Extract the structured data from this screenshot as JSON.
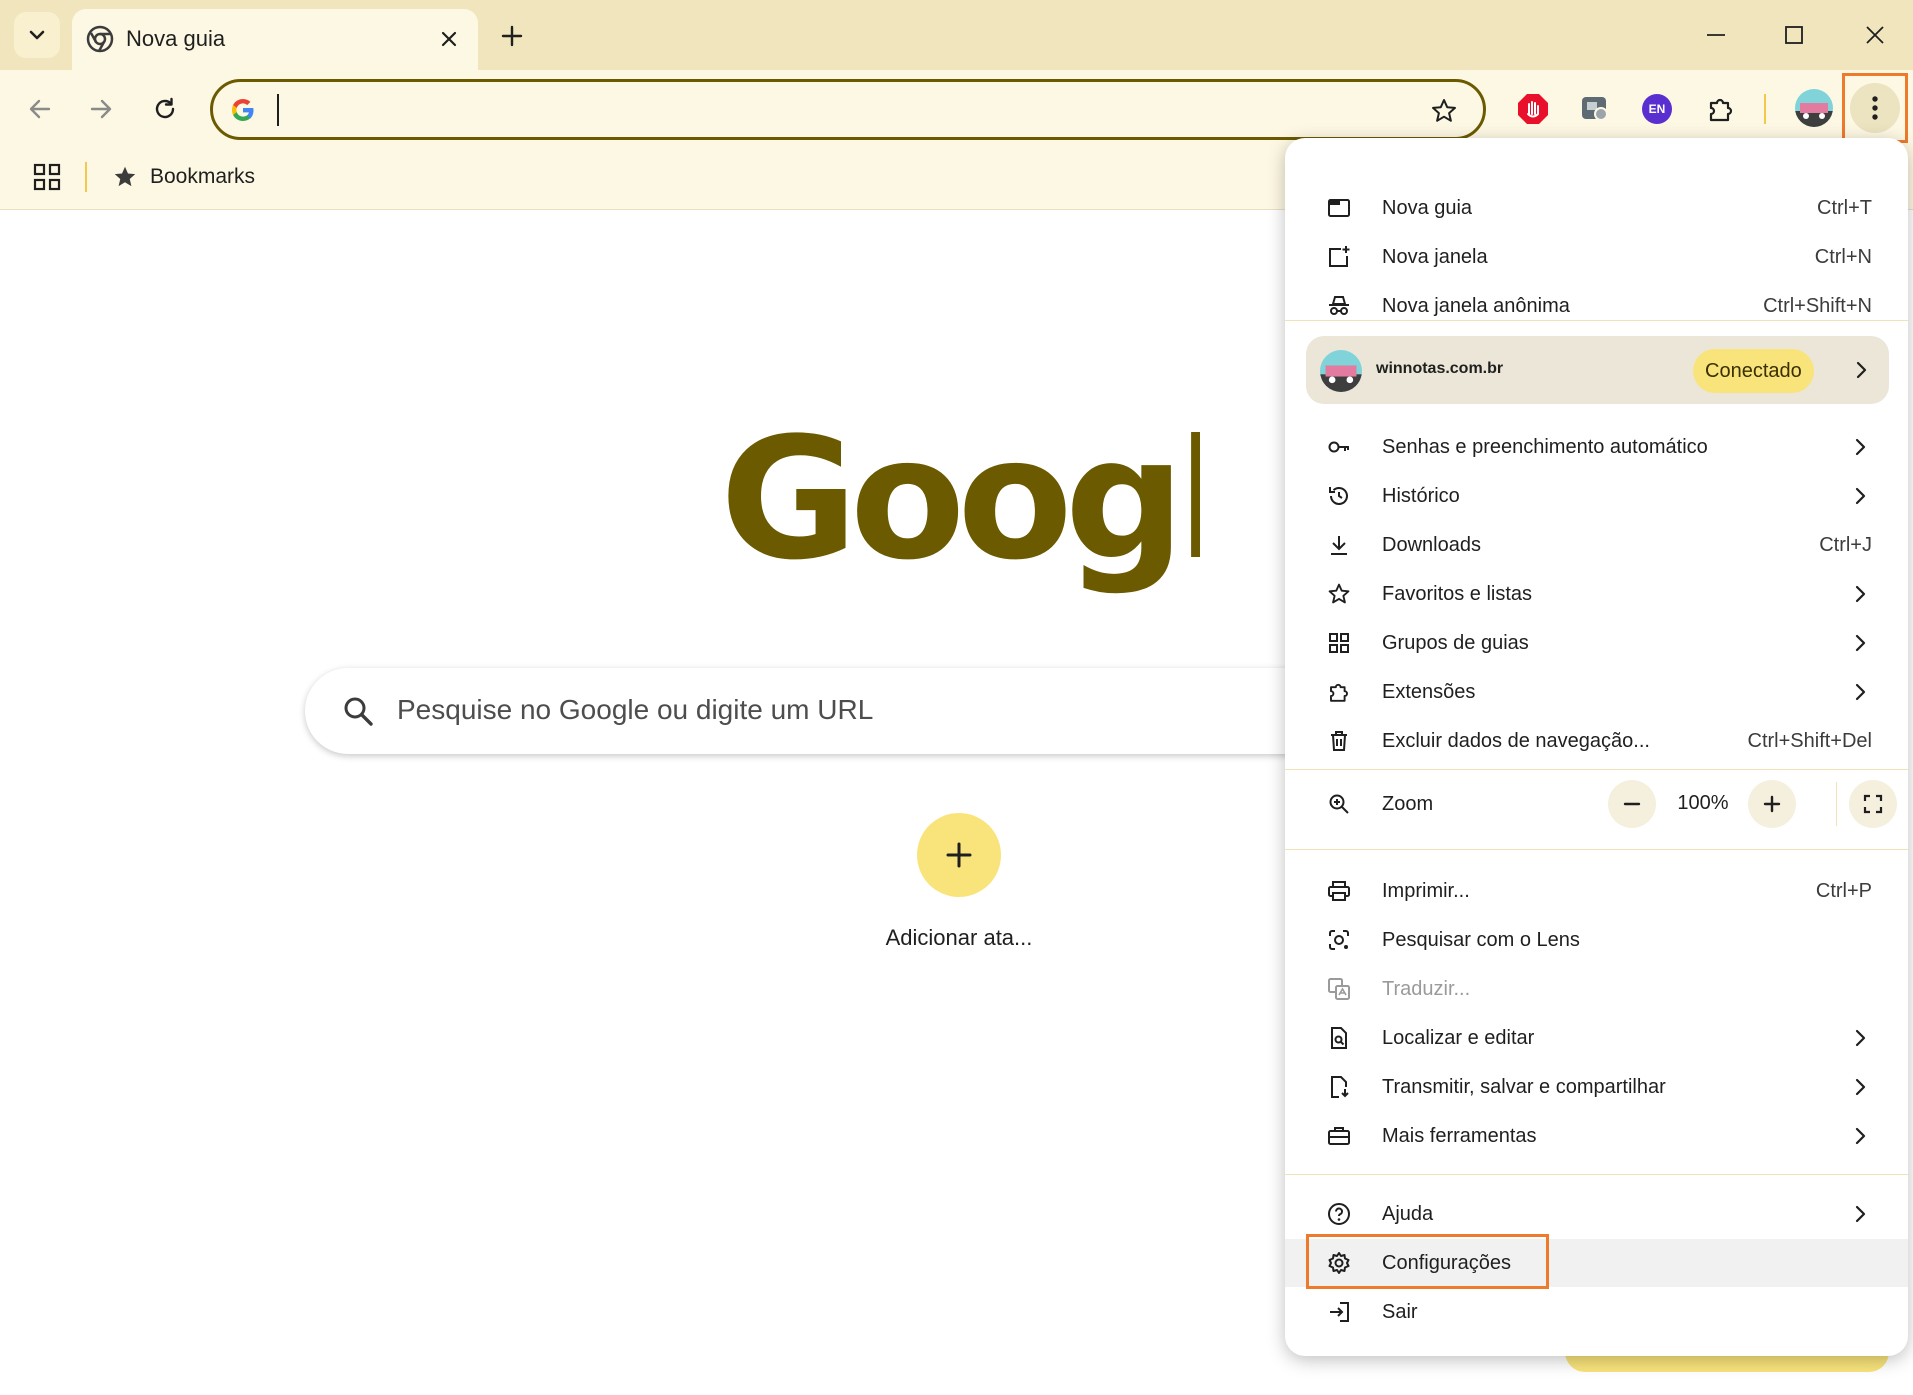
{
  "tab": {
    "title": "Nova guia"
  },
  "bookmarks_bar": {
    "label": "Bookmarks"
  },
  "ntp": {
    "logo_text": "Google",
    "search_placeholder": "Pesquise no Google ou digite um URL",
    "shortcut_label": "Adicionar ata..."
  },
  "extensions": [
    {
      "name": "stop-extension",
      "label": ""
    },
    {
      "name": "puzzle-extension",
      "label": ""
    },
    {
      "name": "language-extension",
      "label": "EN"
    }
  ],
  "colors": {
    "accent": "#6b5a00",
    "tab_strip": "#f0e5bd",
    "toolbar": "#fdf8e3",
    "highlight_box": "#ee7a2c",
    "badge": "#f9e47b"
  },
  "menu": {
    "group1": [
      {
        "label": "Nova guia",
        "shortcut": "Ctrl+T"
      },
      {
        "label": "Nova janela",
        "shortcut": "Ctrl+N"
      },
      {
        "label": "Nova janela anônima",
        "shortcut": "Ctrl+Shift+N"
      }
    ],
    "profile": {
      "name": "winnotas.com.br",
      "status": "Conectado"
    },
    "group2": [
      {
        "label": "Senhas e preenchimento automático",
        "shortcut": ""
      },
      {
        "label": "Histórico",
        "shortcut": ""
      },
      {
        "label": "Downloads",
        "shortcut": "Ctrl+J"
      },
      {
        "label": "Favoritos e listas",
        "shortcut": ""
      },
      {
        "label": "Grupos de guias",
        "shortcut": ""
      },
      {
        "label": "Extensões",
        "shortcut": ""
      },
      {
        "label": "Excluir dados de navegação...",
        "shortcut": "Ctrl+Shift+Del"
      }
    ],
    "zoom": {
      "label": "Zoom",
      "value": "100%"
    },
    "group3": [
      {
        "label": "Imprimir...",
        "shortcut": "Ctrl+P"
      },
      {
        "label": "Pesquisar com o Lens",
        "shortcut": ""
      },
      {
        "label": "Traduzir...",
        "shortcut": ""
      },
      {
        "label": "Localizar e editar",
        "shortcut": ""
      },
      {
        "label": "Transmitir, salvar e compartilhar",
        "shortcut": ""
      },
      {
        "label": "Mais ferramentas",
        "shortcut": ""
      }
    ],
    "group4": [
      {
        "label": "Ajuda",
        "shortcut": ""
      },
      {
        "label": "Configurações",
        "shortcut": ""
      },
      {
        "label": "Sair",
        "shortcut": ""
      }
    ]
  }
}
